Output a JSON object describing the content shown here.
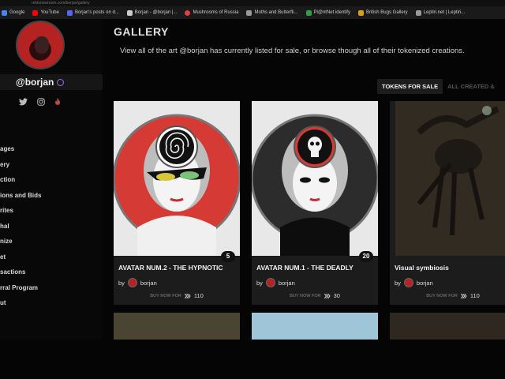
{
  "browser": {
    "url": "rektsnowroom.com/borjan/gallery",
    "bookmarks": [
      {
        "label": "Google",
        "color": "#4285f4"
      },
      {
        "label": "YouTube",
        "color": "#ff0000"
      },
      {
        "label": "Borjan's posts on d...",
        "color": "#5865f2"
      },
      {
        "label": "Borjan - @borjan |...",
        "color": "#cccccc"
      },
      {
        "label": "Mushrooms of Russia",
        "color": "#e04040"
      },
      {
        "label": "Moths and Butterfli...",
        "color": "#cccccc"
      },
      {
        "label": "Pl@ntNet identify",
        "color": "#2f9e44"
      },
      {
        "label": "British Bugs Gallery",
        "color": "#d4a017"
      },
      {
        "label": "Leptiri.net | Leptiri...",
        "color": "#cccccc"
      }
    ]
  },
  "sidebar": {
    "handle": "@borjan",
    "socials": [
      "twitter-icon",
      "instagram-icon",
      "fire-icon"
    ],
    "nav": [
      "ages",
      "ery",
      "ction",
      "ions and Bids",
      "rites",
      "hal",
      "nize",
      "et",
      "sactions",
      "rral Program",
      "ut"
    ]
  },
  "main": {
    "title": "GALLERY",
    "description": "View all of the art @borjan has currently listed for sale, or browse though all of their tokenized creations.",
    "tabs": [
      "TOKENS FOR SALE",
      "ALL CREATED &"
    ]
  },
  "cards": [
    {
      "title": "AVATAR NUM.2 - THE HYPNOTIC",
      "edition": "5",
      "creator_prefix": "by",
      "creator": "borjan",
      "buy_label": "BUY NOW FOR",
      "price": "110",
      "bg": "#d63a35"
    },
    {
      "title": "AVATAR NUM.1 - THE DEADLY",
      "edition": "20",
      "creator_prefix": "by",
      "creator": "borjan",
      "buy_label": "BUY NOW FOR",
      "price": "30",
      "bg": "#2c2c2c"
    },
    {
      "title": "Visual symbiosis",
      "edition": "",
      "creator_prefix": "by",
      "creator": "borjan",
      "buy_label": "BUY NOW FOR",
      "price": "110",
      "bg": "#3a3226"
    }
  ],
  "colors": {
    "accent": "#9b6cf0",
    "brand_red": "#d63a35"
  }
}
